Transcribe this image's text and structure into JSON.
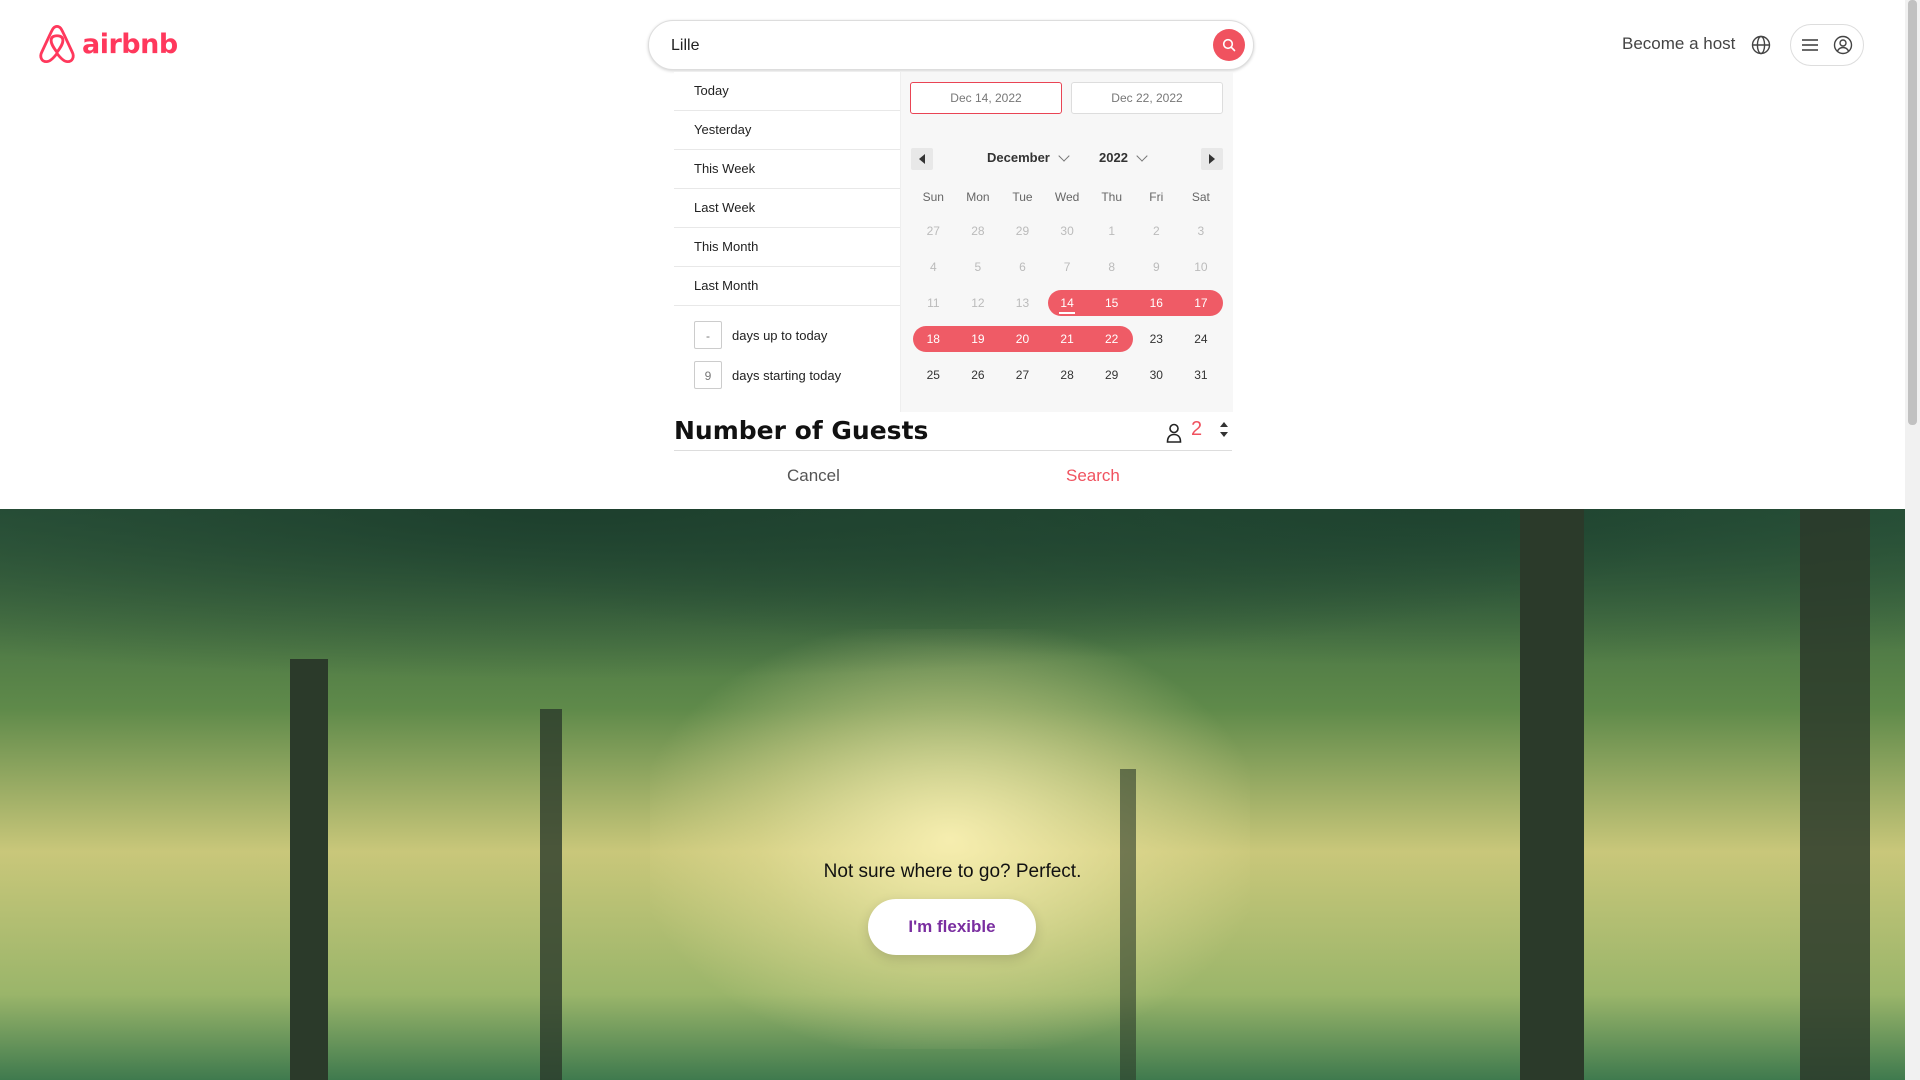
{
  "header": {
    "logo_text": "airbnb",
    "search_value": "Lille",
    "become_host": "Become a host"
  },
  "date_presets": [
    "Today",
    "Yesterday",
    "This Week",
    "Last Week",
    "This Month",
    "Last Month"
  ],
  "relative_days": {
    "up_to_today_value": "-",
    "up_to_today_label": "days up to today",
    "starting_today_value": "9",
    "starting_today_label": "days starting today"
  },
  "calendar": {
    "start_date": "Dec 14, 2022",
    "end_date": "Dec 22, 2022",
    "month": "December",
    "year": "2022",
    "weekdays": [
      "Sun",
      "Mon",
      "Tue",
      "Wed",
      "Thu",
      "Fri",
      "Sat"
    ],
    "weeks": [
      [
        "27",
        "28",
        "29",
        "30",
        "1",
        "2",
        "3"
      ],
      [
        "4",
        "5",
        "6",
        "7",
        "8",
        "9",
        "10"
      ],
      [
        "11",
        "12",
        "13",
        "14",
        "15",
        "16",
        "17"
      ],
      [
        "18",
        "19",
        "20",
        "21",
        "22",
        "23",
        "24"
      ],
      [
        "25",
        "26",
        "27",
        "28",
        "29",
        "30",
        "31"
      ]
    ],
    "selected_range": [
      "14",
      "22"
    ],
    "today": "14"
  },
  "guests": {
    "title": "Number of Guests",
    "value": "2"
  },
  "actions": {
    "cancel": "Cancel",
    "search": "Search"
  },
  "hero": {
    "tagline": "Not sure where to go? Perfect.",
    "button": "I'm flexible"
  },
  "colors": {
    "brand": "#ff385c",
    "range": "#ef5b66",
    "flexible_text": "#7a2ea0"
  }
}
